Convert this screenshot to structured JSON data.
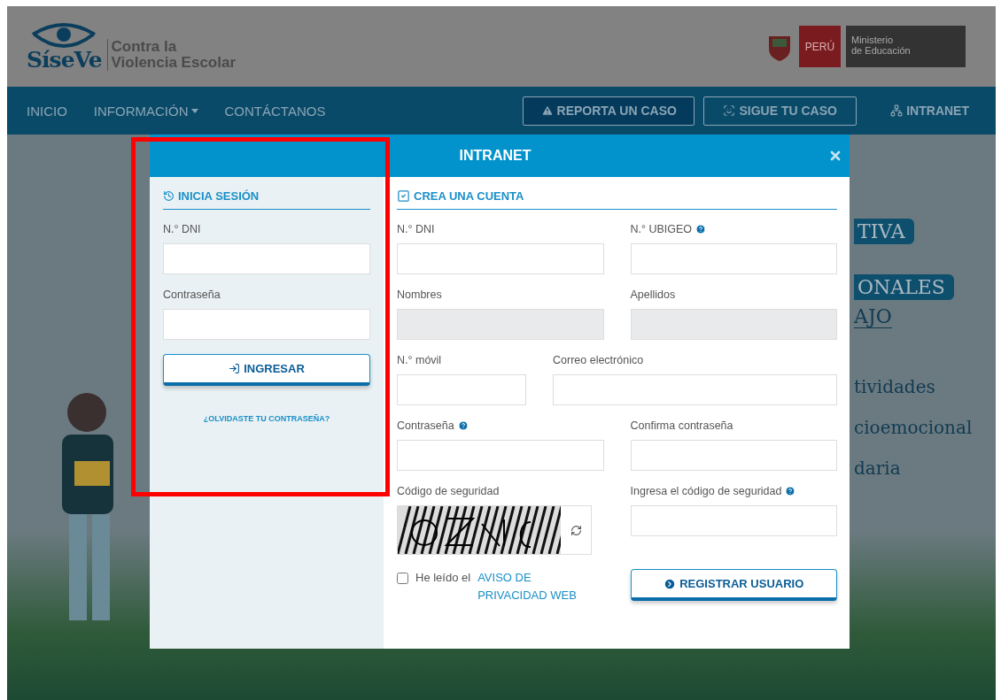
{
  "header": {
    "logo_text": "SíseVe",
    "tagline": [
      "Contra la",
      "Violencia Escolar"
    ],
    "gov_badge": "PERÚ",
    "ministry": [
      "Ministerio",
      "de Educación"
    ]
  },
  "nav": {
    "items": [
      {
        "label": "INICIO",
        "dropdown": false
      },
      {
        "label": "INFORMACIÓN",
        "dropdown": true
      },
      {
        "label": "CONTÁCTANOS",
        "dropdown": false
      }
    ],
    "actions": [
      {
        "label": "REPORTA UN CASO",
        "kind": "filled"
      },
      {
        "label": "SIGUE TU CASO",
        "kind": "outline"
      },
      {
        "label": "INTRANET",
        "kind": "plain"
      }
    ]
  },
  "hero": {
    "lines": [
      {
        "text": "TIVA",
        "kind": "tag"
      },
      {
        "text": "ONALES",
        "kind": "tag"
      },
      {
        "text": "AJO",
        "kind": "underlined"
      },
      {
        "text": "tividades",
        "kind": "body"
      },
      {
        "text": "cioemocional",
        "kind": "body"
      },
      {
        "text": "daria",
        "kind": "body"
      }
    ]
  },
  "modal": {
    "title": "INTRANET",
    "login": {
      "heading": "INICIA SESIÓN",
      "fields": [
        {
          "label": "N.° DNI"
        },
        {
          "label": "Contraseña"
        }
      ],
      "submit": "INGRESAR",
      "forgot": "¿OLVIDASTE TU CONTRASEÑA?"
    },
    "register": {
      "heading": "CREA UNA CUENTA",
      "rows": [
        [
          {
            "label": "N.° DNI",
            "help": false,
            "disabled": false,
            "kind": "half"
          },
          {
            "label": "N.° UBIGEO",
            "help": true,
            "disabled": false,
            "kind": "half"
          }
        ],
        [
          {
            "label": "Nombres",
            "help": false,
            "disabled": true,
            "kind": "half"
          },
          {
            "label": "Apellidos",
            "help": false,
            "disabled": true,
            "kind": "half"
          }
        ],
        [
          {
            "label": "N.° móvil",
            "help": false,
            "disabled": false,
            "kind": "short"
          },
          {
            "label": "Correo electrónico",
            "help": false,
            "disabled": false,
            "kind": "long"
          }
        ],
        [
          {
            "label": "Contraseña",
            "help": true,
            "disabled": false,
            "kind": "half"
          },
          {
            "label": "Confirma contraseña",
            "help": false,
            "disabled": false,
            "kind": "half"
          }
        ],
        [
          {
            "label": "Código de seguridad",
            "help": false,
            "disabled": false,
            "kind": "captcha"
          },
          {
            "label": "Ingresa el código de seguridad",
            "help": true,
            "disabled": false,
            "kind": "half"
          }
        ]
      ],
      "privacy": {
        "checked": false,
        "text": "He leído el",
        "link": "AVISO DE PRIVACIDAD WEB"
      },
      "submit": "REGISTRAR USUARIO"
    }
  }
}
